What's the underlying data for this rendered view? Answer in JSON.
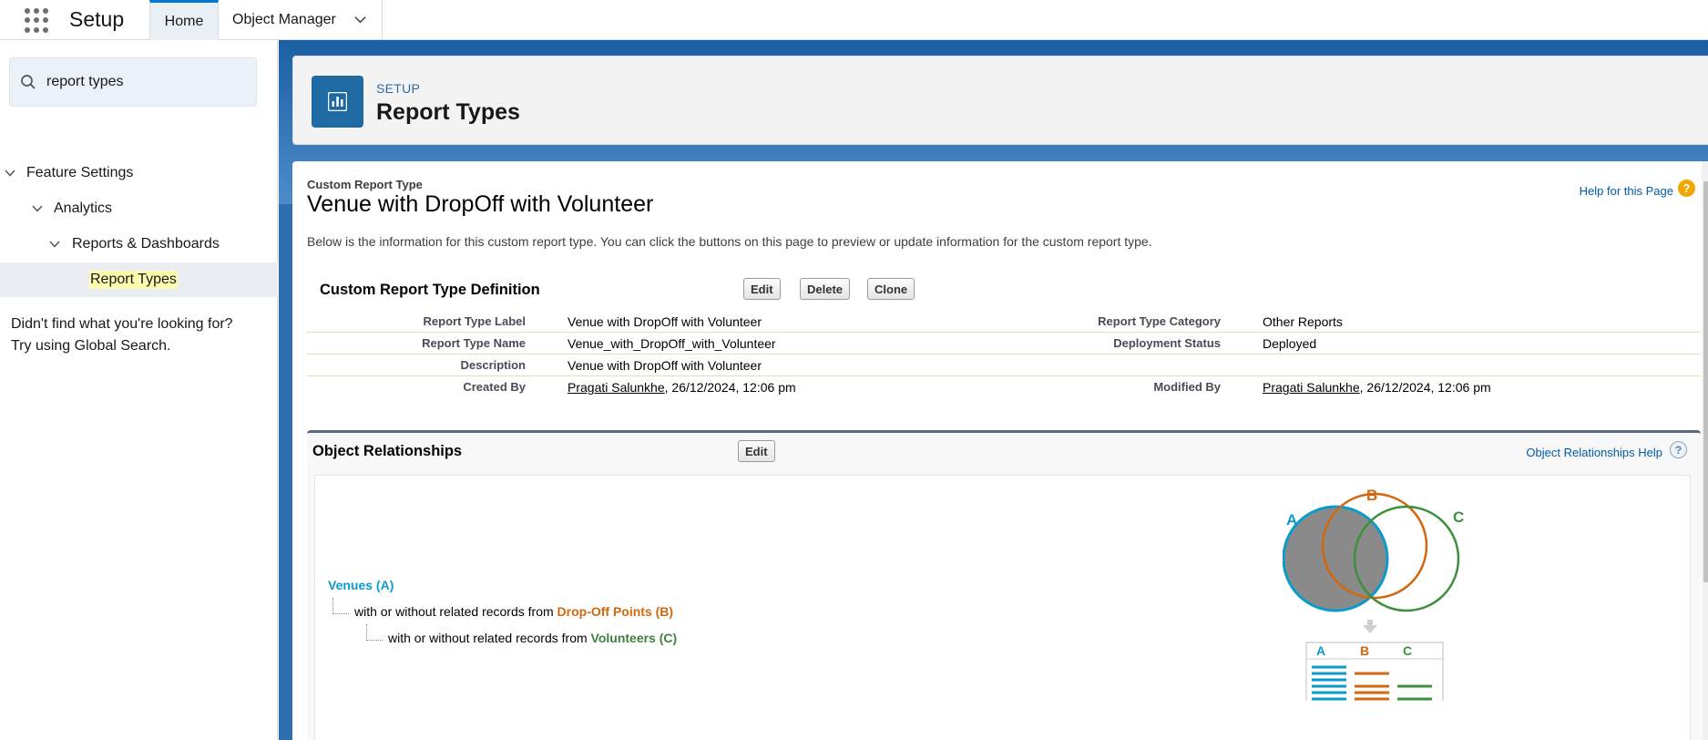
{
  "header": {
    "app_name": "Setup",
    "tabs": [
      {
        "label": "Home",
        "active": true
      },
      {
        "label": "Object Manager",
        "active": false
      }
    ]
  },
  "sidebar": {
    "search": {
      "value": "report types",
      "placeholder": "Quick Find"
    },
    "tree": [
      {
        "label": "Feature Settings",
        "level": 0,
        "expanded": true
      },
      {
        "label": "Analytics",
        "level": 1,
        "expanded": true
      },
      {
        "label": "Reports & Dashboards",
        "level": 2,
        "expanded": true
      },
      {
        "label": "Report Types",
        "level": 3,
        "selected": true
      }
    ],
    "help_line1": "Didn't find what you're looking for?",
    "help_line2": "Try using Global Search."
  },
  "page_header": {
    "eyebrow": "SETUP",
    "title": "Report Types",
    "icon": "report-chart-icon"
  },
  "content": {
    "type_label": "Custom Report Type",
    "title": "Venue with DropOff with Volunteer",
    "help_link": "Help for this Page",
    "intro": "Below is the information for this custom report type. You can click the buttons on this page to preview or update information for the custom report type.",
    "definition": {
      "section_title": "Custom Report Type Definition",
      "buttons": {
        "edit": "Edit",
        "delete": "Delete",
        "clone": "Clone"
      },
      "fields": {
        "report_type_label": {
          "label": "Report Type Label",
          "value": "Venue with DropOff with Volunteer"
        },
        "report_type_name": {
          "label": "Report Type Name",
          "value": "Venue_with_DropOff_with_Volunteer"
        },
        "description": {
          "label": "Description",
          "value": "Venue with DropOff with Volunteer"
        },
        "created_by": {
          "label": "Created By",
          "user": "Pragati Salunkhe",
          "date": ", 26/12/2024, 12:06 pm"
        },
        "category": {
          "label": "Report Type Category",
          "value": "Other Reports"
        },
        "deployment_status": {
          "label": "Deployment Status",
          "value": "Deployed"
        },
        "modified_by": {
          "label": "Modified By",
          "user": "Pragati Salunkhe",
          "date": ", 26/12/2024, 12:06 pm"
        }
      }
    },
    "relationships": {
      "section_title": "Object Relationships",
      "edit_button": "Edit",
      "help_link": "Object Relationships Help",
      "help_icon": "?",
      "object_a": "Venues (A)",
      "line_b_prefix": "with or without related records from ",
      "object_b": "Drop-Off Points (B)",
      "line_c_prefix": "with or without related records from ",
      "object_c": "Volunteers (C)",
      "venn": {
        "a": "A",
        "b": "B",
        "c": "C"
      },
      "colors": {
        "a": "#0b9bcb",
        "b": "#d1670f",
        "c": "#3f8f3d"
      }
    }
  }
}
